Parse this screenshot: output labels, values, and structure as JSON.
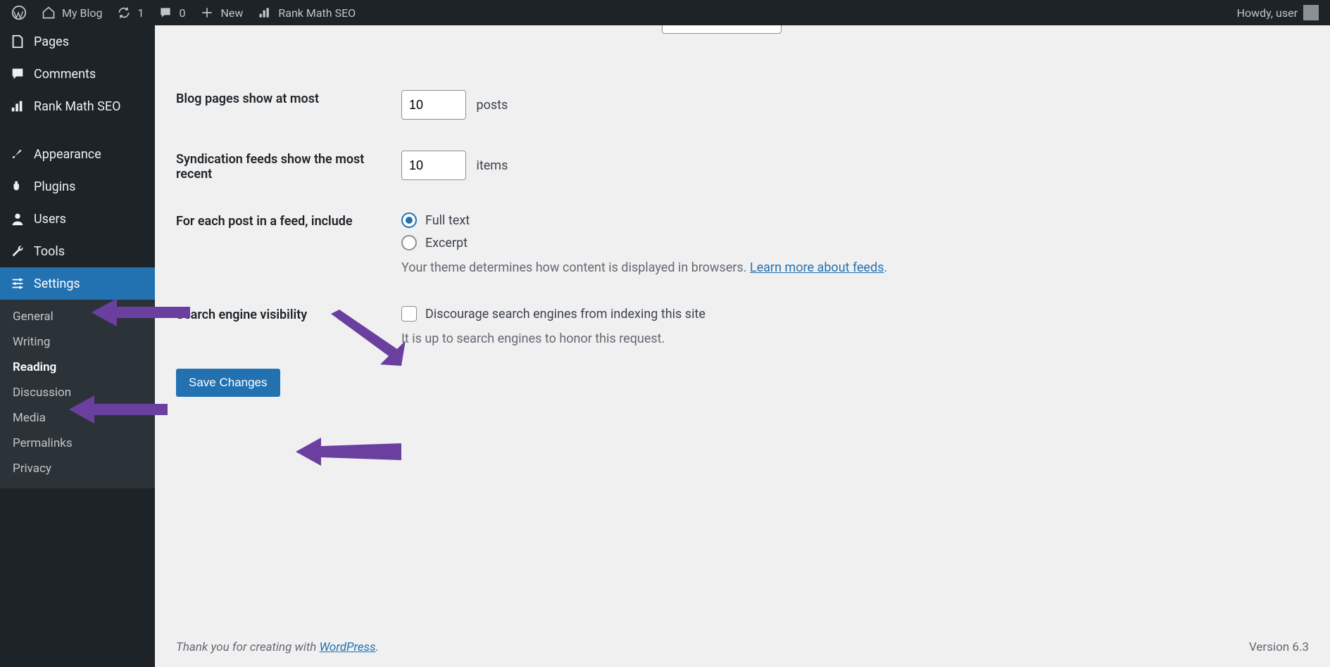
{
  "adminbar": {
    "site_name": "My Blog",
    "updates_count": "1",
    "comments_count": "0",
    "new_label": "New",
    "rankmath_label": "Rank Math SEO",
    "greeting": "Howdy, user"
  },
  "sidebar": {
    "items": [
      {
        "label": "Pages"
      },
      {
        "label": "Comments"
      },
      {
        "label": "Rank Math SEO"
      },
      {
        "label": "Appearance"
      },
      {
        "label": "Plugins"
      },
      {
        "label": "Users"
      },
      {
        "label": "Tools"
      },
      {
        "label": "Settings"
      }
    ],
    "submenu": [
      {
        "label": "General"
      },
      {
        "label": "Writing"
      },
      {
        "label": "Reading"
      },
      {
        "label": "Discussion"
      },
      {
        "label": "Media"
      },
      {
        "label": "Permalinks"
      },
      {
        "label": "Privacy"
      }
    ]
  },
  "settings": {
    "blog_pages_label": "Blog pages show at most",
    "blog_pages_value": "10",
    "blog_pages_suffix": "posts",
    "syndication_label": "Syndication feeds show the most recent",
    "syndication_value": "10",
    "syndication_suffix": "items",
    "feed_include_label": "For each post in a feed, include",
    "feed_opt_full": "Full text",
    "feed_opt_excerpt": "Excerpt",
    "feed_desc_prefix": "Your theme determines how content is displayed in browsers. ",
    "feed_desc_link": "Learn more about feeds",
    "feed_desc_suffix": ".",
    "visibility_label": "Search engine visibility",
    "visibility_checkbox": "Discourage search engines from indexing this site",
    "visibility_desc": "It is up to search engines to honor this request.",
    "save_label": "Save Changes"
  },
  "footer": {
    "thanks_prefix": "Thank you for creating with ",
    "thanks_link": "WordPress",
    "thanks_suffix": ".",
    "version": "Version 6.3"
  }
}
